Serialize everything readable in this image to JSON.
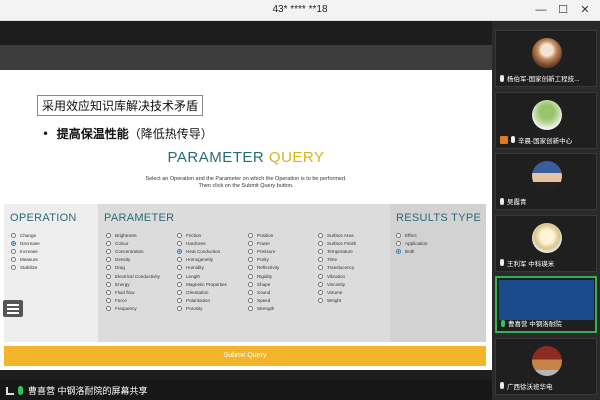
{
  "window": {
    "title": "43* **** **18",
    "controls": {
      "minimize": "—",
      "maximize": "☐",
      "close": "✕"
    }
  },
  "slide": {
    "heading": "采用效应知识库解决技术矛盾",
    "bullet_main": "提高保温性能",
    "bullet_sub": "（降低热传导）",
    "query": {
      "title_part1": "PARAMETER",
      "title_part2": "QUERY",
      "instruction_line1": "Select an Operation and the Parameter on which the Operation is to be performed.",
      "instruction_line2": "Then click on the Submit Query button.",
      "operation": {
        "title": "OPERATION",
        "options": [
          "Change",
          "Decrease",
          "Increase",
          "Measure",
          "Stabilize"
        ],
        "selected": "Decrease"
      },
      "parameter": {
        "title": "PARAMETER",
        "columns": [
          [
            "Brightness",
            "Colour",
            "Concentration",
            "Density",
            "Drag",
            "Electrical Conductivity",
            "Energy",
            "Fluid flow",
            "Force",
            "Frequency"
          ],
          [
            "Friction",
            "Hardness",
            "Heat Conduction",
            "Homogeneity",
            "Humidity",
            "Length",
            "Magnetic Properties",
            "Orientation",
            "Polarisation",
            "Porosity"
          ],
          [
            "Position",
            "Power",
            "Pressure",
            "Purity",
            "Reflectivity",
            "Rigidity",
            "Shape",
            "Sound",
            "Speed",
            "Strength"
          ],
          [
            "Surface Area",
            "Surface Finish",
            "Temperature",
            "Time",
            "Translucency",
            "Vibration",
            "Viscosity",
            "Volume",
            "Weight"
          ]
        ],
        "selected": "Heat Conduction"
      },
      "results": {
        "title": "RESULTS TYPE",
        "options": [
          "Effect",
          "Application",
          "Both"
        ],
        "selected": "Both"
      },
      "submit_label": "Submit Query"
    }
  },
  "bottom_bar": {
    "sharing_label": "曹喜营 中钢洛耐院的屏幕共享"
  },
  "participants": [
    {
      "name": "杨伯军-国家创新工程技...",
      "mic": "white",
      "icon": "mic",
      "avatar": "flower"
    },
    {
      "name": "辛晨-国家创新中心",
      "mic": "white",
      "icon": "person-mic",
      "avatar": "tree"
    },
    {
      "name": "吴霞青",
      "mic": "white",
      "icon": "mic",
      "avatar": "man-suit"
    },
    {
      "name": "王利军 中科瑛米",
      "mic": "white",
      "icon": "mic",
      "avatar": "cartoon"
    },
    {
      "name": "曹喜营 中钢洛耐院",
      "mic": "green",
      "icon": "mic",
      "avatar": "screen",
      "active": true
    },
    {
      "name": "广西徐沃班华电",
      "mic": "white",
      "icon": "mic",
      "avatar": "house"
    }
  ],
  "colors": {
    "accent_teal": "#2b6b77",
    "accent_gold": "#d3b51a",
    "submit": "#f2b42a",
    "active_border": "#36b052"
  }
}
